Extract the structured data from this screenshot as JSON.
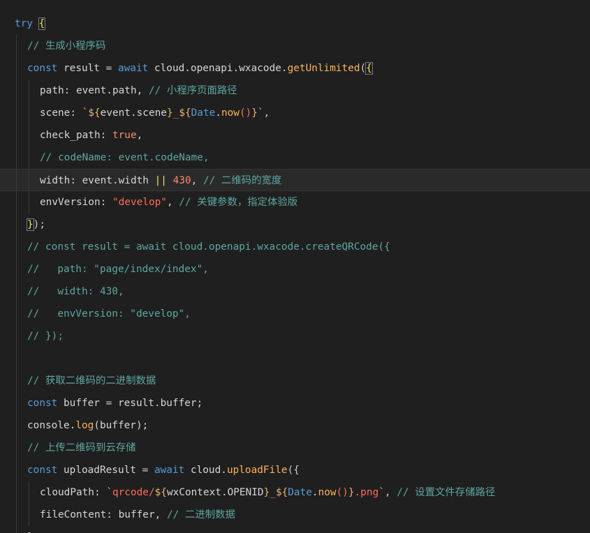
{
  "editor": {
    "colors": {
      "background": "#1f1f1f",
      "keyword": "#569cd6",
      "function": "#ffb25a",
      "string": "#e6b673",
      "number": "#f78c6c",
      "comment": "#5ea7a0"
    },
    "lines": [
      {
        "indent": 0,
        "tokens": [
          {
            "t": "try",
            "c": "kw"
          },
          {
            "t": " ",
            "c": "pun"
          },
          {
            "t": "{",
            "c": "brk"
          }
        ]
      },
      {
        "indent": 1,
        "tokens": [
          {
            "t": "// 生成小程序码",
            "c": "cmt"
          }
        ]
      },
      {
        "indent": 1,
        "tokens": [
          {
            "t": "const",
            "c": "kw"
          },
          {
            "t": " result = ",
            "c": "var"
          },
          {
            "t": "await",
            "c": "kw"
          },
          {
            "t": " cloud.openapi.wxacode.",
            "c": "var"
          },
          {
            "t": "getUnlimited",
            "c": "fn"
          },
          {
            "t": "(",
            "c": "pun"
          },
          {
            "t": "{",
            "c": "brk"
          }
        ]
      },
      {
        "indent": 2,
        "tokens": [
          {
            "t": "path: event.path, ",
            "c": "var"
          },
          {
            "t": "// 小程序页面路径",
            "c": "cmt"
          }
        ]
      },
      {
        "indent": 2,
        "tokens": [
          {
            "t": "scene: ",
            "c": "var"
          },
          {
            "t": "`${",
            "c": "str"
          },
          {
            "t": "event.scene",
            "c": "var"
          },
          {
            "t": "}",
            "c": "str"
          },
          {
            "t": "_",
            "c": "stru"
          },
          {
            "t": "${",
            "c": "str"
          },
          {
            "t": "Date",
            "c": "cls"
          },
          {
            "t": ".",
            "c": "var"
          },
          {
            "t": "now",
            "c": "fn"
          },
          {
            "t": "()",
            "c": "stru"
          },
          {
            "t": "}`",
            "c": "str"
          },
          {
            "t": ",",
            "c": "pun"
          }
        ]
      },
      {
        "indent": 2,
        "tokens": [
          {
            "t": "check_path: ",
            "c": "var"
          },
          {
            "t": "true",
            "c": "bool"
          },
          {
            "t": ",",
            "c": "pun"
          }
        ]
      },
      {
        "indent": 2,
        "tokens": [
          {
            "t": "// codeName: event.codeName,",
            "c": "cmt"
          }
        ]
      },
      {
        "indent": 2,
        "current": true,
        "tokens": [
          {
            "t": "width: event.width ",
            "c": "var"
          },
          {
            "t": "||",
            "c": "op"
          },
          {
            "t": " ",
            "c": "pun"
          },
          {
            "t": "430",
            "c": "num"
          },
          {
            "t": ", ",
            "c": "pun"
          },
          {
            "t": "// 二维码的宽度",
            "c": "cmt"
          }
        ]
      },
      {
        "indent": 2,
        "tokens": [
          {
            "t": "envVersion: ",
            "c": "var"
          },
          {
            "t": "\"develop\"",
            "c": "stru"
          },
          {
            "t": ", ",
            "c": "pun"
          },
          {
            "t": "// 关键参数，指定体验版",
            "c": "cmt"
          }
        ]
      },
      {
        "indent": 1,
        "tokens": [
          {
            "t": "}",
            "c": "brk"
          },
          {
            "t": ");",
            "c": "pun"
          }
        ]
      },
      {
        "indent": 1,
        "tokens": [
          {
            "t": "// const result = await cloud.openapi.wxacode.createQRCode({",
            "c": "cmt"
          }
        ]
      },
      {
        "indent": 1,
        "tokens": [
          {
            "t": "//   path: \"page/index/index\",",
            "c": "cmt"
          }
        ]
      },
      {
        "indent": 1,
        "tokens": [
          {
            "t": "//   width: 430,",
            "c": "cmt"
          }
        ]
      },
      {
        "indent": 1,
        "tokens": [
          {
            "t": "//   envVersion: \"develop\",",
            "c": "cmt"
          }
        ]
      },
      {
        "indent": 1,
        "tokens": [
          {
            "t": "// });",
            "c": "cmt"
          }
        ]
      },
      {
        "indent": 1,
        "tokens": []
      },
      {
        "indent": 1,
        "tokens": [
          {
            "t": "// 获取二维码的二进制数据",
            "c": "cmt"
          }
        ]
      },
      {
        "indent": 1,
        "tokens": [
          {
            "t": "const",
            "c": "kw"
          },
          {
            "t": " buffer = result.buffer;",
            "c": "var"
          }
        ]
      },
      {
        "indent": 1,
        "tokens": [
          {
            "t": "console.",
            "c": "var"
          },
          {
            "t": "log",
            "c": "fn"
          },
          {
            "t": "(buffer);",
            "c": "var"
          }
        ]
      },
      {
        "indent": 1,
        "tokens": [
          {
            "t": "// 上传二维码到云存储",
            "c": "cmt"
          }
        ]
      },
      {
        "indent": 1,
        "tokens": [
          {
            "t": "const",
            "c": "kw"
          },
          {
            "t": " uploadResult = ",
            "c": "var"
          },
          {
            "t": "await",
            "c": "kw"
          },
          {
            "t": " cloud.",
            "c": "var"
          },
          {
            "t": "uploadFile",
            "c": "fn"
          },
          {
            "t": "({",
            "c": "pun"
          }
        ]
      },
      {
        "indent": 2,
        "tokens": [
          {
            "t": "cloudPath: ",
            "c": "var"
          },
          {
            "t": "`",
            "c": "str"
          },
          {
            "t": "qrcode/",
            "c": "stru"
          },
          {
            "t": "${",
            "c": "str"
          },
          {
            "t": "wxContext.OPENID",
            "c": "var"
          },
          {
            "t": "}",
            "c": "str"
          },
          {
            "t": "_",
            "c": "stru"
          },
          {
            "t": "${",
            "c": "str"
          },
          {
            "t": "Date",
            "c": "cls"
          },
          {
            "t": ".",
            "c": "var"
          },
          {
            "t": "now",
            "c": "fn"
          },
          {
            "t": "()",
            "c": "stru"
          },
          {
            "t": "}",
            "c": "str"
          },
          {
            "t": ".png",
            "c": "stru"
          },
          {
            "t": "`",
            "c": "str"
          },
          {
            "t": ", ",
            "c": "pun"
          },
          {
            "t": "// 设置文件存储路径",
            "c": "cmt"
          }
        ]
      },
      {
        "indent": 2,
        "tokens": [
          {
            "t": "fileContent: buffer, ",
            "c": "var"
          },
          {
            "t": "// 二进制数据",
            "c": "cmt"
          }
        ]
      },
      {
        "indent": 1,
        "tokens": [
          {
            "t": "}",
            "c": "pun"
          }
        ]
      }
    ]
  }
}
